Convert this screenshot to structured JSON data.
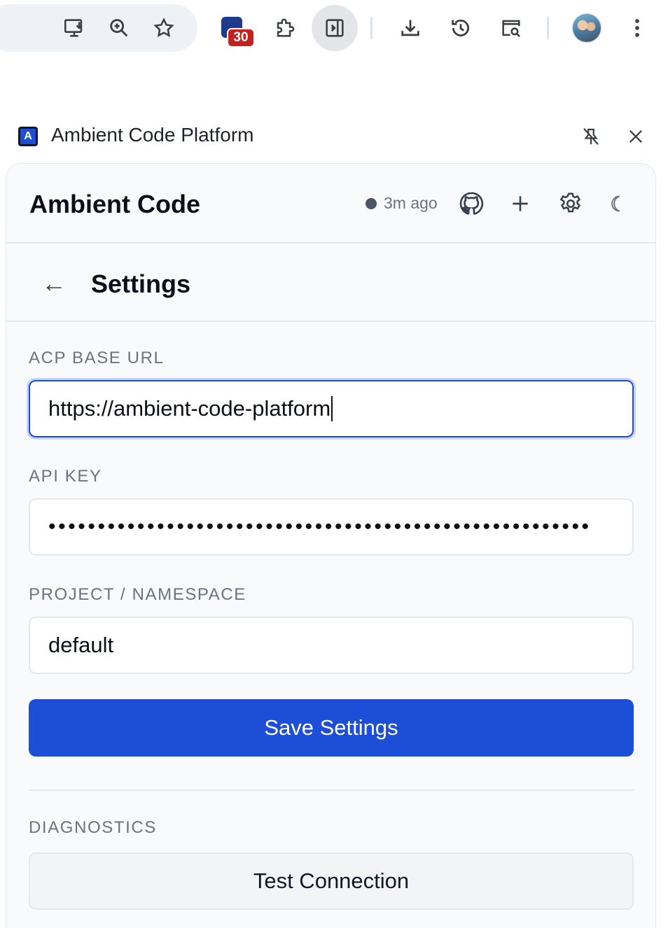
{
  "browser_toolbar": {
    "icons": [
      "install-app-icon",
      "zoom-icon",
      "bookmark-star-icon",
      "acp-extension-icon",
      "extensions-puzzle-icon",
      "side-panel-icon",
      "downloads-icon",
      "history-icon",
      "tab-search-icon",
      "profile-avatar",
      "more-menu-icon"
    ],
    "extension_badge": "30"
  },
  "side_panel": {
    "favicon_letter": "A",
    "title": "Ambient Code Platform"
  },
  "app": {
    "title": "Ambient Code",
    "status_text": "3m ago",
    "header_icons": [
      "github-icon",
      "plus-icon",
      "gear-icon",
      "moon-icon"
    ]
  },
  "settings": {
    "back_glyph": "←",
    "title": "Settings",
    "base_url_label": "ACP BASE URL",
    "base_url_value": "https://ambient-code-platform",
    "api_key_label": "API KEY",
    "api_key_masked": "•••••••••••••••••••••••••••••••••••••••••••••••••••••••",
    "namespace_label": "PROJECT / NAMESPACE",
    "namespace_value": "default",
    "save_label": "Save Settings",
    "diagnostics_label": "DIAGNOSTICS",
    "test_label": "Test Connection"
  },
  "colors": {
    "primary": "#1d4ed8",
    "badge": "#c5221f",
    "status_dot": "#4b5563"
  }
}
